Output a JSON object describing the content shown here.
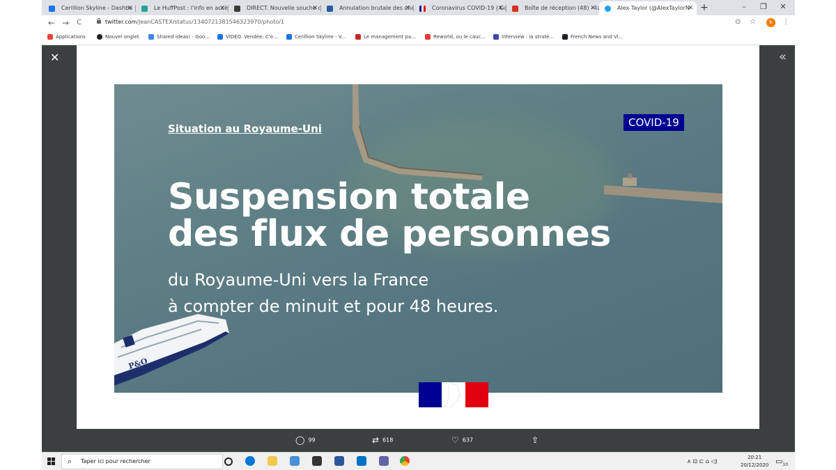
{
  "browser": {
    "tabs": [
      {
        "title": "Cerillion Skyline - Dashbo",
        "color": "#1a73e8"
      },
      {
        "title": "Le HuffPost : l'info en accè",
        "color": "#2aa198"
      },
      {
        "title": "DIRECT. Nouvelle souche c",
        "color": "#3c3c3c"
      },
      {
        "title": "Annulation brutale des cha",
        "color": "#2c5aa0"
      },
      {
        "title": "Coronavirus COVID-19 | Go",
        "color": "#e1000f"
      },
      {
        "title": "Boîte de réception (48) - liz",
        "color": "#d93025"
      },
      {
        "title": "Alex Taylor (@AlexTaylorN",
        "color": "#1da1f2"
      }
    ],
    "new_tab_label": "+",
    "window_controls": {
      "minimize": "–",
      "restore": "❐",
      "close": "✕"
    },
    "nav": {
      "back": "←",
      "forward": "→",
      "reload": "C"
    },
    "url_host": "twitter.com",
    "url_path": "/JeanCASTEX/status/1340721381546323970/photo/1",
    "profile_initial": "b",
    "bookmarks": [
      {
        "label": "Applications",
        "color": "#ea4335"
      },
      {
        "label": "Nouvel onglet",
        "color": "#202124"
      },
      {
        "label": "Shared ideas! - Goo...",
        "color": "#4285f4"
      },
      {
        "label": "VIDEO. Vendée: C'e...",
        "color": "#1a73e8"
      },
      {
        "label": "Cerillion Skyline - V...",
        "color": "#1a73e8"
      },
      {
        "label": "Le management pa...",
        "color": "#c62828"
      },
      {
        "label": "Reworld, ou le cauc...",
        "color": "#e53935"
      },
      {
        "label": "Interview : la stratè...",
        "color": "#3949ab"
      },
      {
        "label": "French News and Vi...",
        "color": "#202124"
      }
    ]
  },
  "viewer": {
    "close_icon": "✕",
    "collapse_icon": "«",
    "image": {
      "section_label": "Situation au Royaume-Uni",
      "badge": "COVID-19",
      "headline_line1": "Suspension totale",
      "headline_line2": "des flux de personnes",
      "sub_line1": "du Royaume-Uni vers la France",
      "sub_line2": "à compter de minuit et pour 48 heures.",
      "ship_text": "P&O",
      "colors": {
        "badge_bg": "#000091",
        "flag_blue": "#000091",
        "flag_red": "#e1000f"
      }
    },
    "actions": {
      "replies": "99",
      "retweets": "618",
      "likes": "637"
    }
  },
  "taskbar": {
    "search_placeholder": "Taper ici pour rechercher",
    "time": "20:21",
    "date": "20/12/2020",
    "tray_symbols": "∧ ⊡ ⊏ ⌂ ◁)",
    "notification_count": "10"
  }
}
